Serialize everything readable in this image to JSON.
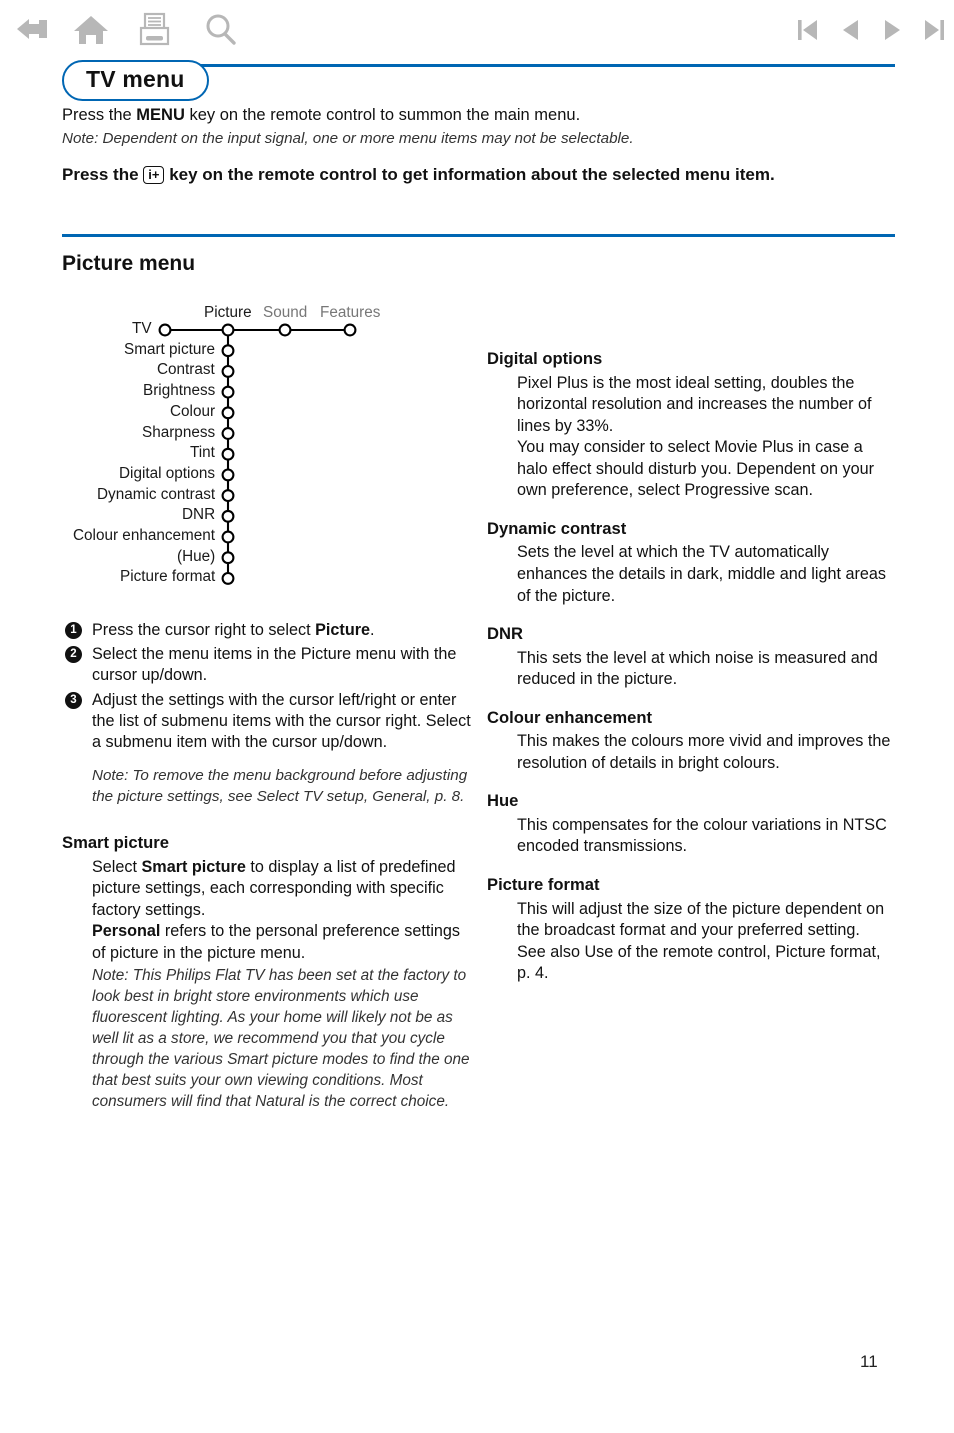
{
  "toolbar": {
    "left_icons": [
      {
        "name": "back-icon",
        "label": "Back"
      },
      {
        "name": "home-icon",
        "label": "Home"
      },
      {
        "name": "print-icon",
        "label": "Print"
      },
      {
        "name": "search-icon",
        "label": "Search"
      }
    ],
    "right_icons": [
      {
        "name": "first-page-icon",
        "label": "First page"
      },
      {
        "name": "previous-page-icon",
        "label": "Previous page"
      },
      {
        "name": "next-page-icon",
        "label": "Next page"
      },
      {
        "name": "last-page-icon",
        "label": "Last page"
      }
    ]
  },
  "colors": {
    "accent_blue": "#0066b3",
    "icon_gray": "#b7b7b7",
    "dim_text": "#777777",
    "body_text": "#1a1a1a"
  },
  "header": {
    "badge_title": "TV menu"
  },
  "intro": {
    "line_prefix": "Press the ",
    "line_bold": "MENU",
    "line_suffix": " key on the remote control to summon the main menu.",
    "note": "Note: Dependent on the input signal, one or more menu items may not be selectable.",
    "info_prefix": "Press the ",
    "info_icon_label": "i+",
    "info_suffix": " key on the remote control to get information about the selected menu item."
  },
  "section": {
    "title": "Picture menu"
  },
  "tree": {
    "root_label": "TV",
    "columns": [
      {
        "label": "Picture",
        "state": "active"
      },
      {
        "label": "Sound",
        "state": "dim"
      },
      {
        "label": "Features",
        "state": "dim"
      }
    ],
    "items": [
      "Smart picture",
      "Contrast",
      "Brightness",
      "Colour",
      "Sharpness",
      "Tint",
      "Digital options",
      "Dynamic contrast",
      "DNR",
      "Colour enhancement",
      "(Hue)",
      "Picture format"
    ]
  },
  "steps": [
    {
      "number": "1",
      "pre": "Press the cursor right to select ",
      "bold": "Picture",
      "post": "."
    },
    {
      "number": "2",
      "pre": "Select the menu items in the Picture menu with the cursor up/down.",
      "bold": "",
      "post": ""
    },
    {
      "number": "3",
      "pre": "Adjust the settings with the cursor left/right or enter the list of submenu items with the cursor right. Select a submenu item with the cursor up/down.",
      "bold": "",
      "post": ""
    }
  ],
  "steps_note": "Note: To remove the menu background before adjusting the picture settings, see Select TV setup, General, p. 8.",
  "smart_picture": {
    "heading": "Smart picture",
    "para1_pre": "Select ",
    "para1_bold": "Smart picture",
    "para1_post": " to display a list of predefined picture settings, each corresponding with specific factory settings.",
    "para2_bold": "Personal",
    "para2_post": " refers to the personal preference settings of picture in the picture menu.",
    "note": "Note: This Philips Flat TV has been set at the factory to look best in bright store environments which use fluorescent lighting. As your home will likely not be as well lit as a store, we recommend you that you cycle through the various Smart picture modes to find the one that best suits your own viewing conditions. Most consumers will find that Natural is the correct choice."
  },
  "right_sections": [
    {
      "heading": "Digital options",
      "paragraphs": [
        "Pixel Plus is the most ideal setting, doubles the horizontal resolution and increases the number of lines by 33%.",
        "You may consider to select Movie Plus in case a halo effect should disturb you. Dependent on your own preference, select Progressive scan."
      ]
    },
    {
      "heading": "Dynamic contrast",
      "paragraphs": [
        "Sets the level at which the TV automatically enhances the details in dark, middle and light areas of the picture."
      ]
    },
    {
      "heading": "DNR",
      "paragraphs": [
        "This sets the level at which noise is measured and reduced in the picture."
      ]
    },
    {
      "heading": "Colour enhancement",
      "paragraphs": [
        "This makes the colours more vivid and improves the resolution of details in bright colours."
      ]
    },
    {
      "heading": "Hue",
      "paragraphs": [
        "This compensates for the colour variations in NTSC encoded transmissions."
      ]
    },
    {
      "heading": "Picture format",
      "paragraphs": [
        "This will adjust the size of the picture dependent on the broadcast format and your preferred setting.",
        "See also Use of the remote control, Picture format, p. 4."
      ]
    }
  ],
  "footer": {
    "page_number": "11"
  }
}
